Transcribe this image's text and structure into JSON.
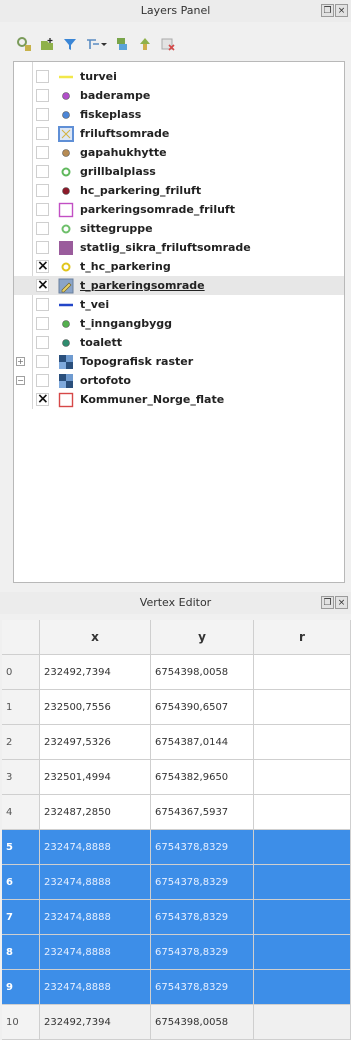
{
  "layers_panel": {
    "title": "Layers Panel",
    "float_button": "❐",
    "close_button": "×"
  },
  "toolbar": {
    "icons": [
      "style-manager-icon",
      "add-group-icon",
      "filter-legend-icon",
      "filter-by-expression-icon",
      "expand-all-icon",
      "collapse-all-icon",
      "remove-layer-icon"
    ]
  },
  "layers": [
    {
      "name": "turvei",
      "checked": false,
      "symbol": "line",
      "color": "#f2e84a"
    },
    {
      "name": "baderampe",
      "checked": false,
      "symbol": "point",
      "color": "#b14fc9"
    },
    {
      "name": "fiskeplass",
      "checked": false,
      "symbol": "point",
      "color": "#4d86d6"
    },
    {
      "name": "friluftsomrade",
      "checked": false,
      "symbol": "polygon-pattern",
      "color": "#5f8fd6"
    },
    {
      "name": "gapahukhytte",
      "checked": false,
      "symbol": "point",
      "color": "#b68b54"
    },
    {
      "name": "grillbalplass",
      "checked": false,
      "symbol": "point-ring",
      "color": "#5fb85c"
    },
    {
      "name": "hc_parkering_friluft",
      "checked": false,
      "symbol": "point",
      "color": "#8c1a2a"
    },
    {
      "name": "parkeringsomrade_friluft",
      "checked": false,
      "symbol": "polygon-outline",
      "color": "#c24fc4"
    },
    {
      "name": "sittegruppe",
      "checked": false,
      "symbol": "point-ring",
      "color": "#6dbf6a"
    },
    {
      "name": "statlig_sikra_friluftsomrade",
      "checked": false,
      "symbol": "polygon-fill",
      "color": "#9a5c9c"
    },
    {
      "name": "t_hc_parkering",
      "checked": true,
      "symbol": "point-ring",
      "color": "#e0c51a"
    },
    {
      "name": "t_parkeringsomrade",
      "checked": true,
      "symbol": "polygon-edit",
      "color": "#8aa4c8"
    },
    {
      "name": "t_vei",
      "checked": false,
      "symbol": "line",
      "color": "#2246c8"
    },
    {
      "name": "t_inngangbygg",
      "checked": false,
      "symbol": "point",
      "color": "#55b04f"
    },
    {
      "name": "toalett",
      "checked": false,
      "symbol": "point",
      "color": "#2f8c6e"
    },
    {
      "name": "Topografisk raster",
      "checked": false,
      "symbol": "raster",
      "color": "#2a4f7c",
      "expander": "+"
    },
    {
      "name": "ortofoto",
      "checked": false,
      "symbol": "raster",
      "color": "#2a4f7c",
      "expander": "−"
    },
    {
      "name": "Kommuner_Norge_flate",
      "checked": true,
      "symbol": "polygon-outline",
      "color": "#d64848"
    }
  ],
  "vertex_editor": {
    "title": "Vertex Editor",
    "float_button": "❐",
    "close_button": "×",
    "columns": [
      "x",
      "y",
      "r"
    ],
    "rows": [
      {
        "num": "0",
        "x": "232492,7394",
        "y": "6754398,0058",
        "r": "",
        "selected": false
      },
      {
        "num": "1",
        "x": "232500,7556",
        "y": "6754390,6507",
        "r": "",
        "selected": false
      },
      {
        "num": "2",
        "x": "232497,5326",
        "y": "6754387,0144",
        "r": "",
        "selected": false
      },
      {
        "num": "3",
        "x": "232501,4994",
        "y": "6754382,9650",
        "r": "",
        "selected": false
      },
      {
        "num": "4",
        "x": "232487,2850",
        "y": "6754367,5937",
        "r": "",
        "selected": false
      },
      {
        "num": "5",
        "x": "232474,8888",
        "y": "6754378,8329",
        "r": "",
        "selected": true
      },
      {
        "num": "6",
        "x": "232474,8888",
        "y": "6754378,8329",
        "r": "",
        "selected": true
      },
      {
        "num": "7",
        "x": "232474,8888",
        "y": "6754378,8329",
        "r": "",
        "selected": true
      },
      {
        "num": "8",
        "x": "232474,8888",
        "y": "6754378,8329",
        "r": "",
        "selected": true
      },
      {
        "num": "9",
        "x": "232474,8888",
        "y": "6754378,8329",
        "r": "",
        "selected": true
      },
      {
        "num": "10",
        "x": "232492,7394",
        "y": "6754398,0058",
        "r": "",
        "selected": false
      }
    ]
  }
}
